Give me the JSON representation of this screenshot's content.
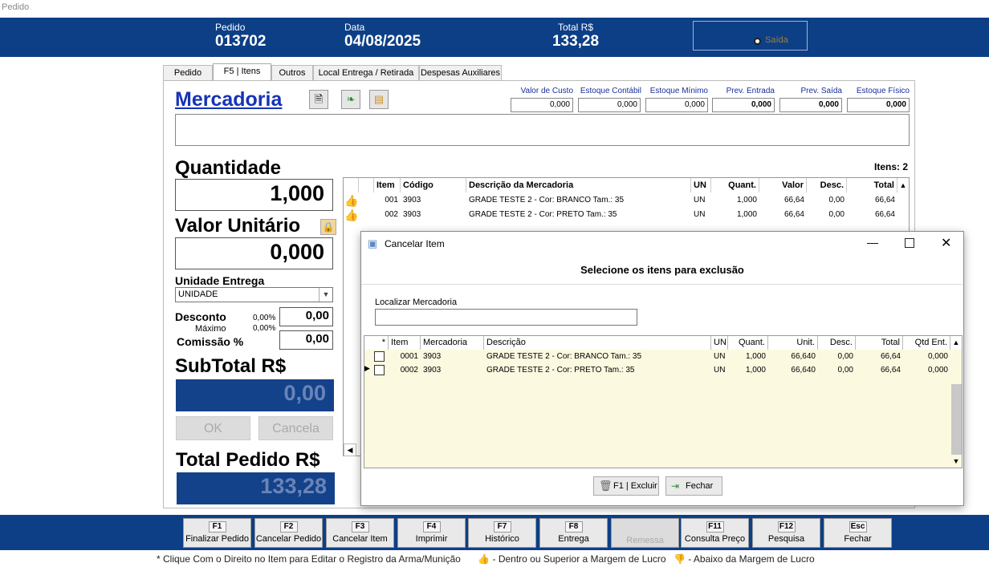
{
  "window": {
    "title": "Pedido"
  },
  "header": {
    "pedido_label": "Pedido",
    "pedido_value": "013702",
    "data_label": "Data",
    "data_value": "04/08/2025",
    "total_label": "Total R$",
    "total_value": "133,28",
    "saida_label": "Saída"
  },
  "tabs": [
    {
      "label": "Pedido",
      "active": false
    },
    {
      "label": "F5 | Itens",
      "active": true
    },
    {
      "label": "Outros",
      "active": false
    },
    {
      "label": "Local Entrega / Retirada",
      "active": false
    },
    {
      "label": "Despesas Auxiliares",
      "active": false
    }
  ],
  "mercadoria": {
    "title": "Mercadoria"
  },
  "stock": [
    {
      "label": "Valor de Custo",
      "value": "0,000",
      "bold": false
    },
    {
      "label": "Estoque Contábil",
      "value": "0,000",
      "bold": false
    },
    {
      "label": "Estoque Mínimo",
      "value": "0,000",
      "bold": false
    },
    {
      "label": "Prev. Entrada",
      "value": "0,000",
      "bold": true
    },
    {
      "label": "Prev. Saída",
      "value": "0,000",
      "bold": true
    },
    {
      "label": "Estoque Físico",
      "value": "0,000",
      "bold": true
    }
  ],
  "left": {
    "quantidade_label": "Quantidade",
    "quantidade_value": "1,000",
    "valor_unit_label": "Valor Unitário",
    "valor_unit_value": "0,000",
    "unidade_label": "Unidade Entrega",
    "unidade_value": "UNIDADE",
    "desconto_label": "Desconto",
    "desconto_pct": "0,00%",
    "desconto_value": "0,00",
    "maximo_label": "Máximo",
    "maximo_pct": "0,00%",
    "comissao_label": "Comissão %",
    "comissao_value": "0,00",
    "subtotal_label": "SubTotal R$",
    "subtotal_value": "0,00",
    "ok_label": "OK",
    "cancela_label": "Cancela",
    "total_pedido_label": "Total Pedido R$",
    "total_pedido_value": "133,28"
  },
  "items_grid": {
    "count_label": "Itens: 2",
    "columns": [
      "Item",
      "Código",
      "Descrição da Mercadoria",
      "UN",
      "Quant.",
      "Valor",
      "Desc.",
      "Total"
    ],
    "rows": [
      [
        "001",
        "3903",
        "GRADE TESTE 2 - Cor: BRANCO Tam.: 35",
        "UN",
        "1,000",
        "66,64",
        "0,00",
        "66,64"
      ],
      [
        "002",
        "3903",
        "GRADE TESTE 2 - Cor: PRETO Tam.: 35",
        "UN",
        "1,000",
        "66,64",
        "0,00",
        "66,64"
      ]
    ]
  },
  "dialog": {
    "title": "Cancelar Item",
    "subtitle": "Selecione os itens para exclusão",
    "search_label": "Localizar Mercadoria",
    "search_value": "",
    "columns": [
      "*",
      "Item",
      "Mercadoria",
      "Descrição",
      "UN",
      "Quant.",
      "Unit.",
      "Desc.",
      "Total",
      "Qtd Ent."
    ],
    "rows": [
      [
        "0001",
        "3903",
        "GRADE TESTE 2 - Cor: BRANCO Tam.: 35",
        "UN",
        "1,000",
        "66,640",
        "0,00",
        "66,64",
        "0,000"
      ],
      [
        "0002",
        "3903",
        "GRADE TESTE 2 - Cor: PRETO Tam.: 35",
        "UN",
        "1,000",
        "66,640",
        "0,00",
        "66,64",
        "0,000"
      ]
    ],
    "excluir_label": "F1 | Excluir",
    "fechar_label": "Fechar"
  },
  "footer": [
    {
      "key": "F1",
      "label": "Finalizar Pedido",
      "enabled": true
    },
    {
      "key": "F2",
      "label": "Cancelar Pedido",
      "enabled": true
    },
    {
      "key": "F3",
      "label": "Cancelar Item",
      "enabled": true
    },
    {
      "key": "F4",
      "label": "Imprimir",
      "enabled": true
    },
    {
      "key": "F7",
      "label": "Histórico",
      "enabled": true
    },
    {
      "key": "F8",
      "label": "Entrega",
      "enabled": true
    },
    {
      "key": "",
      "label": "Remessa",
      "enabled": false
    },
    {
      "key": "F11",
      "label": "Consulta Preço",
      "enabled": true
    },
    {
      "key": "F12",
      "label": "Pesquisa",
      "enabled": true
    },
    {
      "key": "Esc",
      "label": "Fechar",
      "enabled": true
    }
  ],
  "legend": {
    "note": "* Clique Com o Direito no Item para Editar o Registro da Arma/Munição",
    "above": "- Dentro ou Superior a Margem de Lucro",
    "below": "- Abaixo da Margem de Lucro"
  }
}
